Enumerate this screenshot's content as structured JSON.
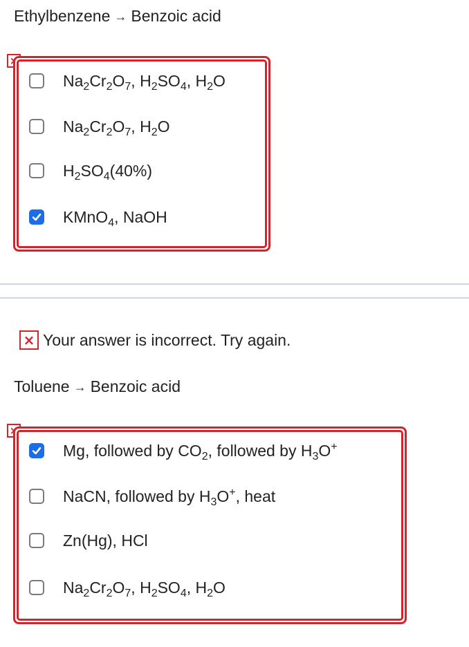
{
  "q1": {
    "from": "Ethylbenzene",
    "arrow": "→",
    "to": "Benzoic acid",
    "marker": "×",
    "options": [
      {
        "checked": false,
        "parts": [
          [
            "Na",
            ""
          ],
          [
            "2",
            "sub"
          ],
          [
            "Cr",
            ""
          ],
          [
            "2",
            "sub"
          ],
          [
            "O",
            ""
          ],
          [
            "7",
            "sub"
          ],
          [
            ", H",
            ""
          ],
          [
            "2",
            "sub"
          ],
          [
            "SO",
            ""
          ],
          [
            "4",
            "sub"
          ],
          [
            ", H",
            ""
          ],
          [
            "2",
            "sub"
          ],
          [
            "O",
            ""
          ]
        ]
      },
      {
        "checked": false,
        "parts": [
          [
            "Na",
            ""
          ],
          [
            "2",
            "sub"
          ],
          [
            "Cr",
            ""
          ],
          [
            "2",
            "sub"
          ],
          [
            "O",
            ""
          ],
          [
            "7",
            "sub"
          ],
          [
            ", H",
            ""
          ],
          [
            "2",
            "sub"
          ],
          [
            "O",
            ""
          ]
        ]
      },
      {
        "checked": false,
        "parts": [
          [
            "H",
            ""
          ],
          [
            "2",
            "sub"
          ],
          [
            "SO",
            ""
          ],
          [
            "4",
            "sub"
          ],
          [
            "(40%)",
            ""
          ]
        ]
      },
      {
        "checked": true,
        "parts": [
          [
            "KMnO",
            ""
          ],
          [
            "4",
            "sub"
          ],
          [
            ", NaOH",
            ""
          ]
        ]
      }
    ]
  },
  "feedback": {
    "icon": "×",
    "text": "Your answer is incorrect.  Try again."
  },
  "q2": {
    "from": "Toluene",
    "arrow": "→",
    "to": "Benzoic acid",
    "marker": "×",
    "options": [
      {
        "checked": true,
        "parts": [
          [
            "Mg, followed by CO",
            ""
          ],
          [
            "2",
            "sub"
          ],
          [
            ", followed by H",
            ""
          ],
          [
            "3",
            "sub"
          ],
          [
            "O",
            ""
          ],
          [
            "+",
            "sup"
          ]
        ]
      },
      {
        "checked": false,
        "parts": [
          [
            "NaCN, followed by H",
            ""
          ],
          [
            "3",
            "sub"
          ],
          [
            "O",
            ""
          ],
          [
            "+",
            "sup"
          ],
          [
            ", heat",
            ""
          ]
        ]
      },
      {
        "checked": false,
        "parts": [
          [
            "Zn(Hg), HCl",
            ""
          ]
        ]
      },
      {
        "checked": false,
        "parts": [
          [
            "Na",
            ""
          ],
          [
            "2",
            "sub"
          ],
          [
            "Cr",
            ""
          ],
          [
            "2",
            "sub"
          ],
          [
            "O",
            ""
          ],
          [
            "7",
            "sub"
          ],
          [
            ", H",
            ""
          ],
          [
            "2",
            "sub"
          ],
          [
            "SO",
            ""
          ],
          [
            "4",
            "sub"
          ],
          [
            ", H",
            ""
          ],
          [
            "2",
            "sub"
          ],
          [
            "O",
            ""
          ]
        ]
      }
    ]
  }
}
